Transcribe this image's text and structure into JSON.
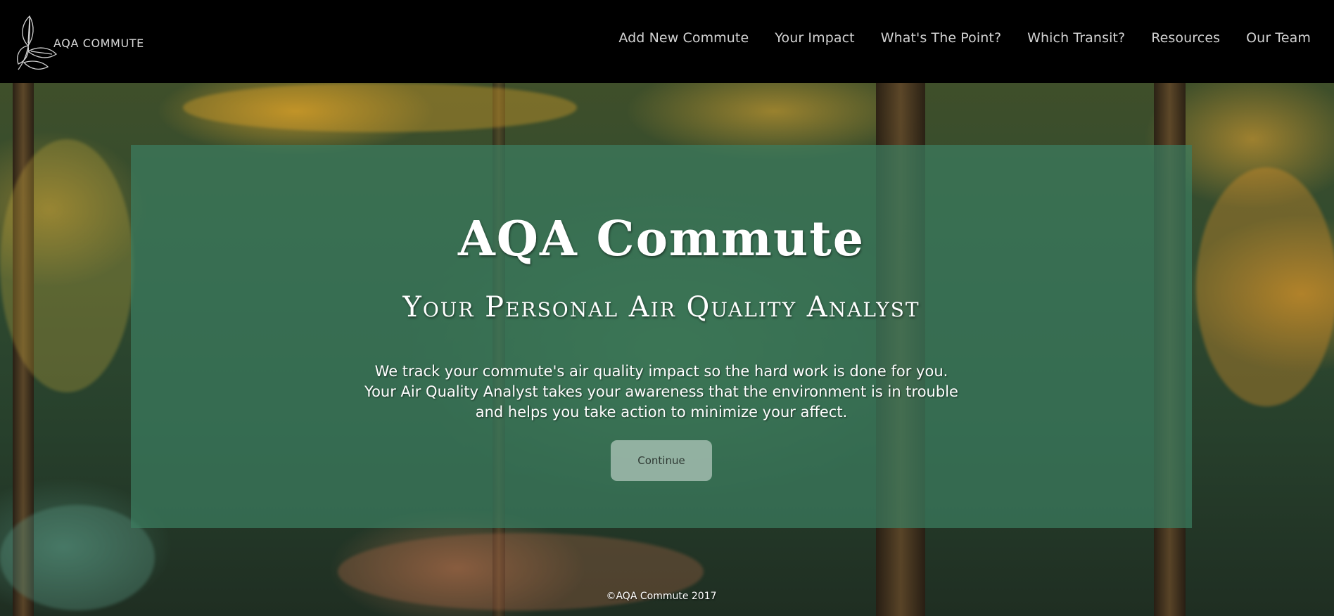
{
  "header": {
    "logo_text": "AQA COMMUTE"
  },
  "nav": {
    "items": [
      {
        "label": "Add New Commute"
      },
      {
        "label": "Your Impact"
      },
      {
        "label": "What's The Point?"
      },
      {
        "label": "Which Transit?"
      },
      {
        "label": "Resources"
      },
      {
        "label": "Our Team"
      }
    ]
  },
  "hero": {
    "title": "AQA Commute",
    "subtitle": "Your Personal Air Quality Analyst",
    "description_lines": [
      "We track your commute's air quality impact so the hard work is done for you.",
      "Your Air Quality Analyst takes your awareness that the environment is in trouble",
      "and helps you take action to minimize your affect."
    ],
    "continue_label": "Continue"
  },
  "footer": {
    "copyright": "©AQA Commute 2017"
  },
  "colors": {
    "header_bg": "#000000",
    "panel_overlay": "#3c7d5f",
    "nav_text": "#d2d2d2",
    "button_bg": "#b9cdc3"
  },
  "icons": {
    "logo": "leaf-branch-icon"
  }
}
